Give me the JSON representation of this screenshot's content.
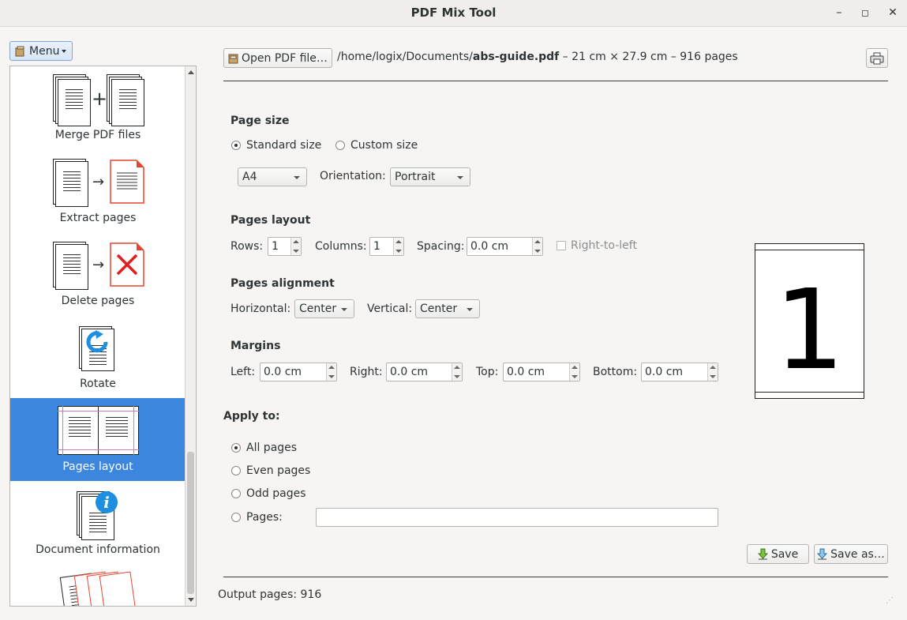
{
  "window": {
    "title": "PDF Mix Tool",
    "minimize": "–",
    "maximize": "◻",
    "close": "✕"
  },
  "menu_button": {
    "label": "Menu"
  },
  "sidebar": {
    "items": [
      {
        "label": "Merge PDF files"
      },
      {
        "label": "Extract pages"
      },
      {
        "label": "Delete pages"
      },
      {
        "label": "Rotate"
      },
      {
        "label": "Pages layout"
      },
      {
        "label": "Document information"
      },
      {
        "label": ""
      }
    ]
  },
  "file_bar": {
    "open_label": "Open PDF file…",
    "path_prefix": "/home/logix/Documents/",
    "filename": "abs-guide.pdf",
    "details": " – 21 cm × 27.9 cm – 916 pages"
  },
  "page_size": {
    "heading": "Page size",
    "standard_label": "Standard size",
    "custom_label": "Custom size",
    "paper": "A4",
    "orientation_label": "Orientation:",
    "orientation": "Portrait"
  },
  "pages_layout": {
    "heading": "Pages layout",
    "rows_label": "Rows:",
    "rows": "1",
    "columns_label": "Columns:",
    "columns": "1",
    "spacing_label": "Spacing:",
    "spacing": "0.0 cm",
    "rtl_label": "Right-to-left"
  },
  "alignment": {
    "heading": "Pages alignment",
    "horizontal_label": "Horizontal:",
    "horizontal": "Center",
    "vertical_label": "Vertical:",
    "vertical": "Center"
  },
  "margins": {
    "heading": "Margins",
    "left_label": "Left:",
    "left": "0.0 cm",
    "right_label": "Right:",
    "right": "0.0 cm",
    "top_label": "Top:",
    "top": "0.0 cm",
    "bottom_label": "Bottom:",
    "bottom": "0.0 cm"
  },
  "preview": {
    "page_number": "1"
  },
  "apply_to": {
    "heading": "Apply to:",
    "all": "All pages",
    "even": "Even pages",
    "odd": "Odd pages",
    "pages": "Pages:"
  },
  "actions": {
    "save": "Save",
    "save_as": "Save as…"
  },
  "status": {
    "output": "Output pages: 916"
  },
  "colors": {
    "selection": "#3c86e0",
    "accent_red": "#e8432d",
    "info_blue": "#1e8fe0"
  }
}
